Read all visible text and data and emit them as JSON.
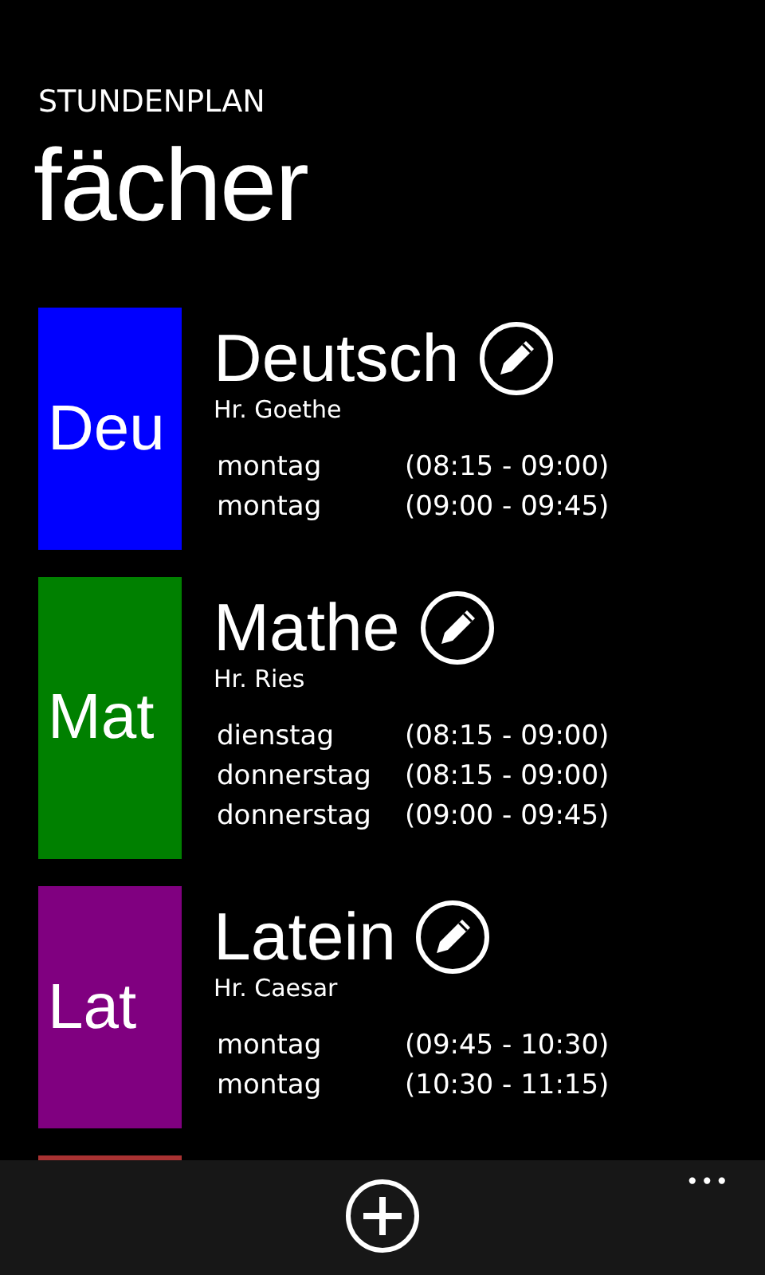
{
  "app_title": "STUNDENPLAN",
  "page_title": "fächer",
  "subjects": [
    {
      "abbr": "Deu",
      "name": "Deutsch",
      "teacher": "Hr. Goethe",
      "color": "#0000ff",
      "sessions": [
        {
          "day": "montag",
          "time": "(08:15 - 09:00)"
        },
        {
          "day": "montag",
          "time": "(09:00 - 09:45)"
        }
      ]
    },
    {
      "abbr": "Mat",
      "name": "Mathe",
      "teacher": "Hr. Ries",
      "color": "#008000",
      "sessions": [
        {
          "day": "dienstag",
          "time": "(08:15 - 09:00)"
        },
        {
          "day": "donnerstag",
          "time": "(08:15 - 09:00)"
        },
        {
          "day": "donnerstag",
          "time": "(09:00 - 09:45)"
        }
      ]
    },
    {
      "abbr": "Lat",
      "name": "Latein",
      "teacher": "Hr. Caesar",
      "color": "#800080",
      "sessions": [
        {
          "day": "montag",
          "time": "(09:45 - 10:30)"
        },
        {
          "day": "montag",
          "time": "(10:30 - 11:15)"
        }
      ]
    },
    {
      "color": "#a83232"
    }
  ],
  "app_bar": {
    "buttons": [
      {
        "kind": "add"
      }
    ],
    "more": "•••"
  }
}
